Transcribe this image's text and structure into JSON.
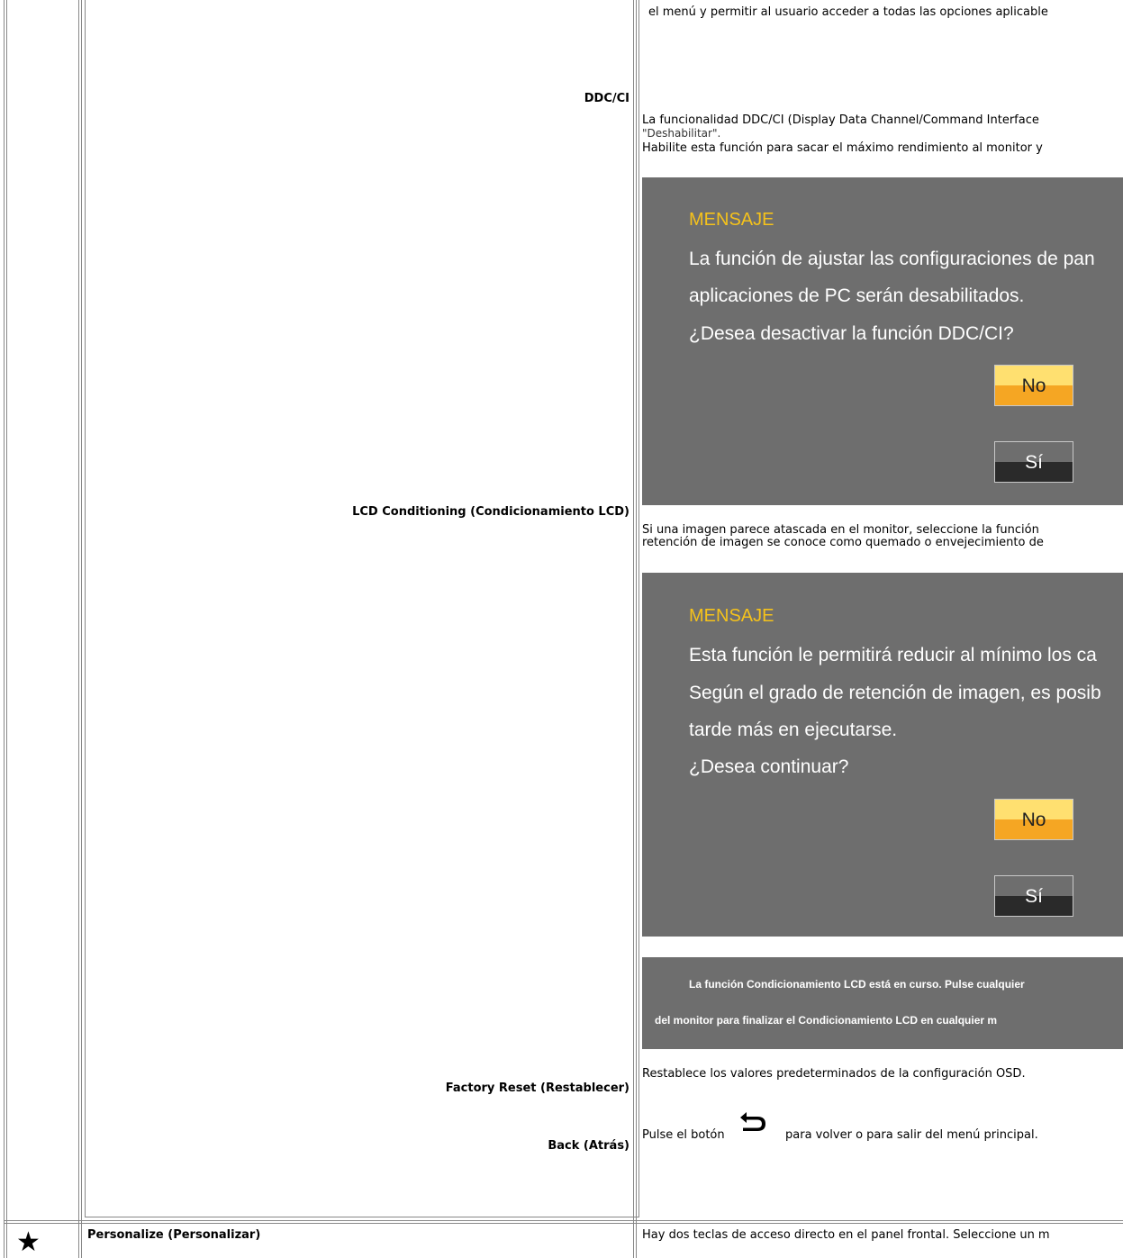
{
  "rows": {
    "top_desc": "el menú y permitir al usuario acceder a todas las opciones aplicable",
    "ddcci": {
      "label": "DDC/CI",
      "desc_line1": "La funcionalidad DDC/CI (Display Data Channel/Command Interface",
      "desc_line2": "\"Deshabilitar\".",
      "desc_line3": "Habilite esta función para sacar el máximo rendimiento al monitor y"
    },
    "lcd": {
      "label": "LCD Conditioning (Condicionamiento LCD)",
      "desc_line1": "Si una imagen parece atascada en el monitor, seleccione la función",
      "desc_line2": "retención de imagen se conoce como quemado o envejecimiento de"
    },
    "factory_reset": {
      "label": "Factory Reset (Restablecer)",
      "desc": "Restablece los valores predeterminados de la configuración OSD."
    },
    "back": {
      "label": "Back (Atrás)",
      "desc_before": "Pulse el botón",
      "desc_after": "para volver o para salir del menú principal.",
      "icon": "back-arrow-icon"
    },
    "personalize": {
      "icon": "star-icon",
      "label": "Personalize (Personalizar)",
      "desc": "Hay dos teclas de acceso directo en el panel frontal. Seleccione un m"
    }
  },
  "osd_ddcci": {
    "title": "MENSAJE",
    "line1": "La función de ajustar las configuraciones de pan",
    "line2": "aplicaciones de PC serán desabilitados.",
    "line3": "¿Desea desactivar la función DDC/CI?",
    "btn_no": "No",
    "btn_si": "Sí"
  },
  "osd_lcd": {
    "title": "MENSAJE",
    "line1": "Esta función le permitirá reducir al mínimo los ca",
    "line2": "Según el grado de retención de imagen, es posib",
    "line3": "tarde más en ejecutarse.",
    "line4": "¿Desea continuar?",
    "btn_no": "No",
    "btn_si": "Sí"
  },
  "osd_progress": {
    "line1": "La función Condicionamiento LCD está en curso. Pulse cualquier",
    "line2": "del monitor para finalizar el Condicionamiento LCD en cualquier m"
  },
  "colors": {
    "osd_bg": "#6e6e6e",
    "osd_title": "#f5c21b",
    "btn_no_top": "#ffe070",
    "btn_no_bottom": "#f5a623"
  }
}
